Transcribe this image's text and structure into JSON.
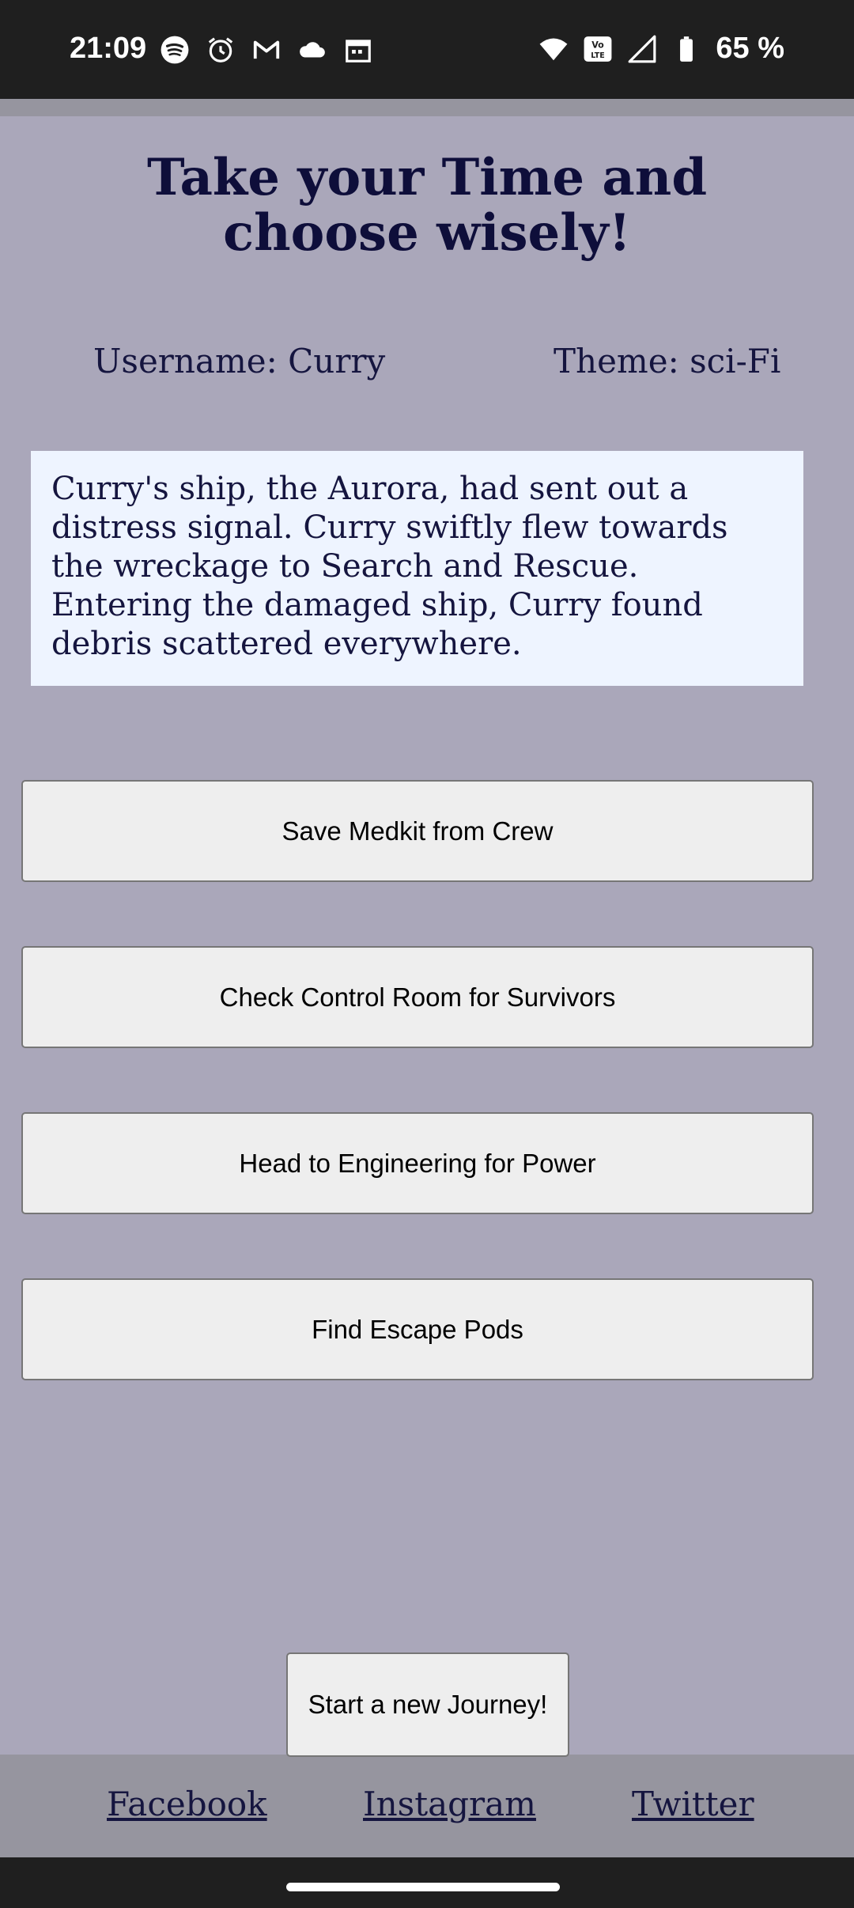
{
  "status_bar": {
    "time": "21:09",
    "left_icons": [
      "spotify-icon",
      "alarm-icon",
      "gmail-icon",
      "cloud-icon",
      "calendar-icon"
    ],
    "right_icons": [
      "wifi-icon",
      "volte-icon",
      "signal-icon",
      "battery-icon"
    ],
    "volte_label": "Vo LTE",
    "battery_text": "65 %"
  },
  "page": {
    "title": "Take your Time and choose wisely!",
    "username": "Username: Curry",
    "theme": "Theme: sci-Fi",
    "story": "Curry's ship, the Aurora, had sent out a distress signal. Curry swiftly flew towards the wreckage to Search and Rescue. Entering the damaged ship, Curry found debris scattered everywhere."
  },
  "choices": [
    {
      "label": "Save Medkit from Crew"
    },
    {
      "label": "Check Control Room for Survivors"
    },
    {
      "label": "Head to Engineering for Power"
    },
    {
      "label": "Find Escape Pods"
    }
  ],
  "new_journey_label": "Start a new Journey!",
  "footer": {
    "facebook": "Facebook",
    "instagram": "Instagram",
    "twitter": "Twitter"
  },
  "colors": {
    "page_bg": "#aaa7ba",
    "footer_bg": "#96959f",
    "text": "#15153f",
    "title": "#0e0e3a",
    "story_bg": "#eef4ff",
    "button_bg": "#eeeeee"
  }
}
